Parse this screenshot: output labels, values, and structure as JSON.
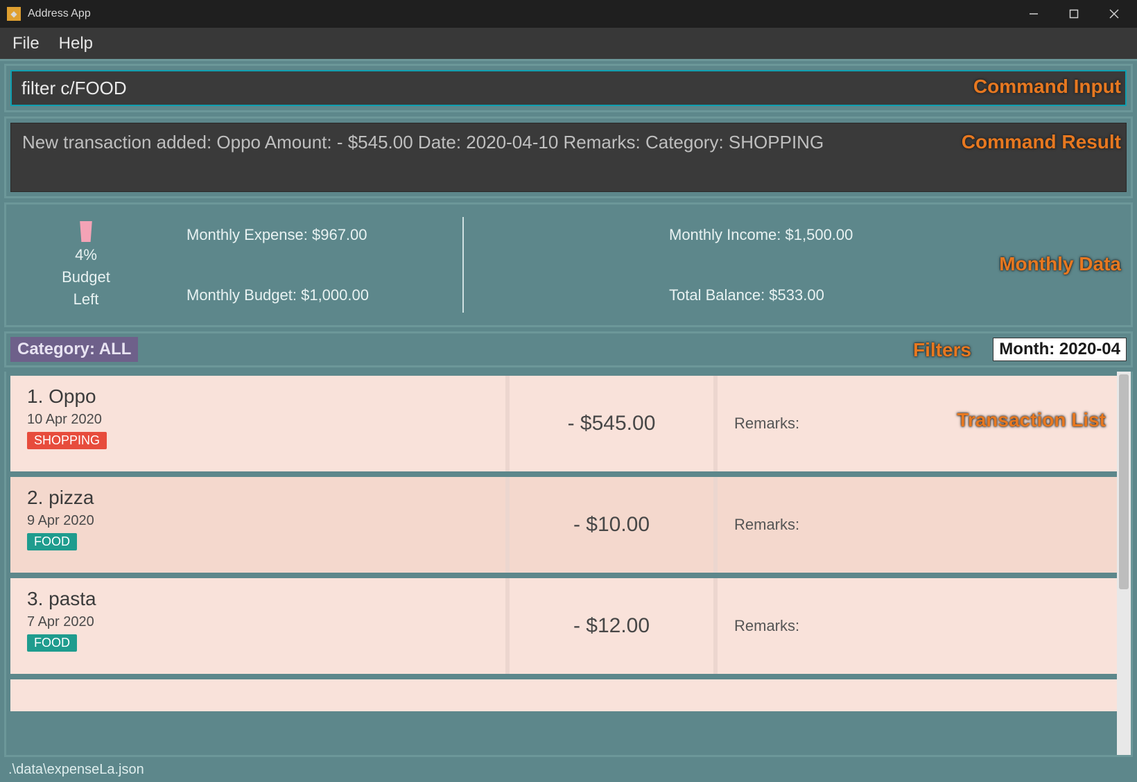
{
  "window": {
    "title": "Address App"
  },
  "menu": {
    "file": "File",
    "help": "Help"
  },
  "command_input": {
    "value": "filter c/FOOD"
  },
  "command_result": {
    "text": "New transaction added: Oppo Amount: - $545.00 Date: 2020-04-10 Remarks:  Category: SHOPPING"
  },
  "monthly": {
    "budget_percent": "4%",
    "budget_label1": "Budget",
    "budget_label2": "Left",
    "expense": "Monthly Expense: $967.00",
    "budget": "Monthly Budget: $1,000.00",
    "income": "Monthly Income: $1,500.00",
    "balance": "Total Balance: $533.00"
  },
  "filters": {
    "category": "Category: ALL",
    "month": "Month: 2020-04"
  },
  "transactions": [
    {
      "idx": "1.",
      "name": "Oppo",
      "date": "10 Apr 2020",
      "tag": "SHOPPING",
      "tag_class": "tag-shopping",
      "amount": "- $545.00",
      "remarks_label": "Remarks:"
    },
    {
      "idx": "2.",
      "name": "pizza",
      "date": "9 Apr 2020",
      "tag": "FOOD",
      "tag_class": "tag-food",
      "amount": "- $10.00",
      "remarks_label": "Remarks:"
    },
    {
      "idx": "3.",
      "name": "pasta",
      "date": "7 Apr 2020",
      "tag": "FOOD",
      "tag_class": "tag-food",
      "amount": "- $12.00",
      "remarks_label": "Remarks:"
    }
  ],
  "status": {
    "path": ".\\data\\expenseLa.json"
  },
  "annotations": {
    "cmd_input": "Command Input",
    "cmd_result": "Command Result",
    "monthly": "Monthly Data",
    "filters": "Filters",
    "tx_list": "Transaction List"
  }
}
